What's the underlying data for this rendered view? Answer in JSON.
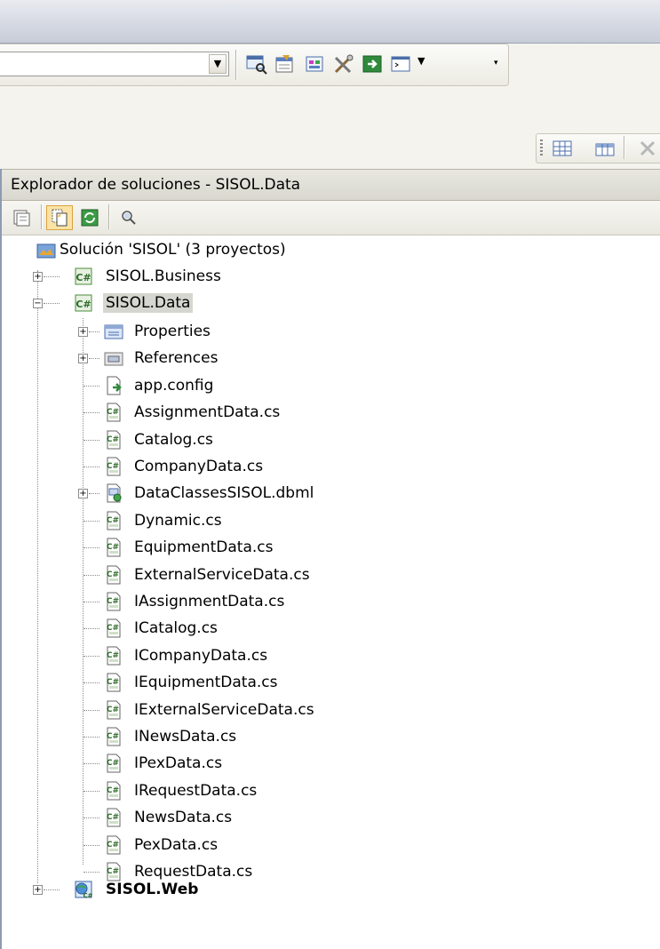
{
  "solution_explorer": {
    "title": "Explorador de soluciones - SISOL.Data",
    "solution_label": "Solución 'SISOL' (3 proyectos)",
    "projects": [
      {
        "label": "SISOL.Business",
        "expanded": false,
        "bold": false
      },
      {
        "label": "SISOL.Data",
        "expanded": true,
        "selected": true,
        "bold": false
      },
      {
        "label": "SISOL.Web",
        "expanded": false,
        "bold": true
      }
    ],
    "data_project_items": [
      {
        "label": "Properties",
        "icon": "properties-folder-icon",
        "expandable": true
      },
      {
        "label": "References",
        "icon": "references-folder-icon",
        "expandable": true
      },
      {
        "label": "app.config",
        "icon": "config-file-icon",
        "expandable": false
      },
      {
        "label": "AssignmentData.cs",
        "icon": "csharp-file-icon",
        "expandable": false
      },
      {
        "label": "Catalog.cs",
        "icon": "csharp-file-icon",
        "expandable": false
      },
      {
        "label": "CompanyData.cs",
        "icon": "csharp-file-icon",
        "expandable": false
      },
      {
        "label": "DataClassesSISOL.dbml",
        "icon": "dbml-file-icon",
        "expandable": true
      },
      {
        "label": "Dynamic.cs",
        "icon": "csharp-file-icon",
        "expandable": false
      },
      {
        "label": "EquipmentData.cs",
        "icon": "csharp-file-icon",
        "expandable": false
      },
      {
        "label": "ExternalServiceData.cs",
        "icon": "csharp-file-icon",
        "expandable": false
      },
      {
        "label": "IAssignmentData.cs",
        "icon": "csharp-file-icon",
        "expandable": false
      },
      {
        "label": "ICatalog.cs",
        "icon": "csharp-file-icon",
        "expandable": false
      },
      {
        "label": "ICompanyData.cs",
        "icon": "csharp-file-icon",
        "expandable": false
      },
      {
        "label": "IEquipmentData.cs",
        "icon": "csharp-file-icon",
        "expandable": false
      },
      {
        "label": "IExternalServiceData.cs",
        "icon": "csharp-file-icon",
        "expandable": false
      },
      {
        "label": "INewsData.cs",
        "icon": "csharp-file-icon",
        "expandable": false
      },
      {
        "label": "IPexData.cs",
        "icon": "csharp-file-icon",
        "expandable": false
      },
      {
        "label": "IRequestData.cs",
        "icon": "csharp-file-icon",
        "expandable": false
      },
      {
        "label": "NewsData.cs",
        "icon": "csharp-file-icon",
        "expandable": false
      },
      {
        "label": "PexData.cs",
        "icon": "csharp-file-icon",
        "expandable": false
      },
      {
        "label": "RequestData.cs",
        "icon": "csharp-file-icon",
        "expandable": false
      }
    ]
  },
  "colors": {
    "selection": "#d6d6d0",
    "panel_border": "#8e9bb1",
    "toolbar_active": "#fbe3a5"
  }
}
